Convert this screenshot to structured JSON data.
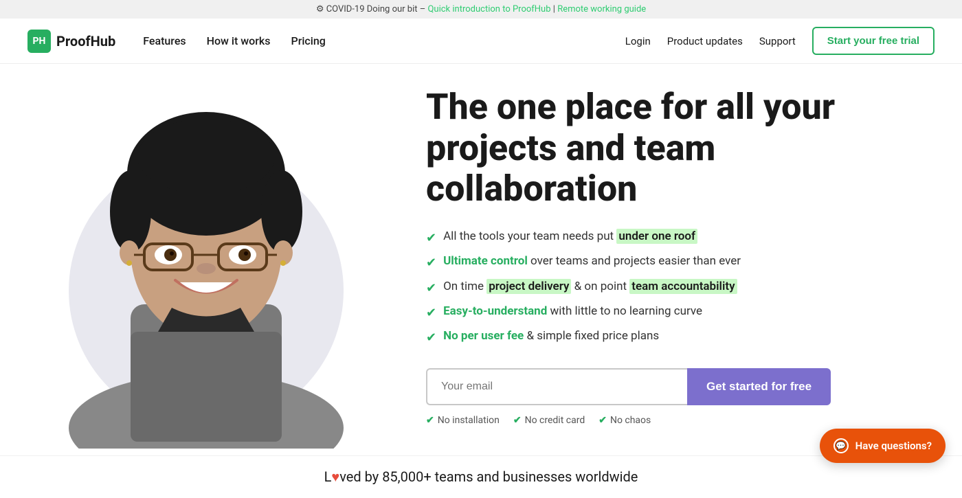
{
  "banner": {
    "prefix": "COVID-19 Doing our bit –",
    "link1_text": "Quick introduction to ProofHub",
    "separator": "|",
    "link2_text": "Remote working guide"
  },
  "nav": {
    "logo_text": "ProofHub",
    "logo_abbr": "PH",
    "links": [
      {
        "label": "Features",
        "href": "#"
      },
      {
        "label": "How it works",
        "href": "#"
      },
      {
        "label": "Pricing",
        "href": "#"
      }
    ],
    "right_links": [
      {
        "label": "Login",
        "href": "#"
      },
      {
        "label": "Product updates",
        "href": "#"
      },
      {
        "label": "Support",
        "href": "#"
      }
    ],
    "cta_label": "Start your free trial"
  },
  "hero": {
    "title": "The one place for all your projects and team collaboration",
    "features": [
      {
        "text_before": "All the tools your team needs put",
        "highlight": "under one roof",
        "text_after": "",
        "highlight_type": "box"
      },
      {
        "text_before": "",
        "highlight": "Ultimate control",
        "text_after": "over teams and projects easier than ever",
        "highlight_type": "text"
      },
      {
        "text_before": "On time",
        "highlight": "project delivery",
        "text_after": "& on point",
        "highlight2": "team accountability",
        "highlight_type": "mixed"
      },
      {
        "text_before": "",
        "highlight": "Easy-to-understand",
        "text_after": "with little to no learning curve",
        "highlight_type": "text"
      },
      {
        "text_before": "",
        "highlight": "No per user fee",
        "text_after": "& simple fixed price plans",
        "highlight_type": "text"
      }
    ],
    "email_placeholder": "Your email",
    "cta_button": "Get started for free",
    "sub_checks": [
      "No installation",
      "No credit card",
      "No chaos"
    ]
  },
  "bottom_banner": {
    "text_before": "L",
    "heart": "♥",
    "text_after": "ved by 85,000+ teams and businesses worldwide"
  },
  "chat": {
    "label": "Have questions?"
  }
}
